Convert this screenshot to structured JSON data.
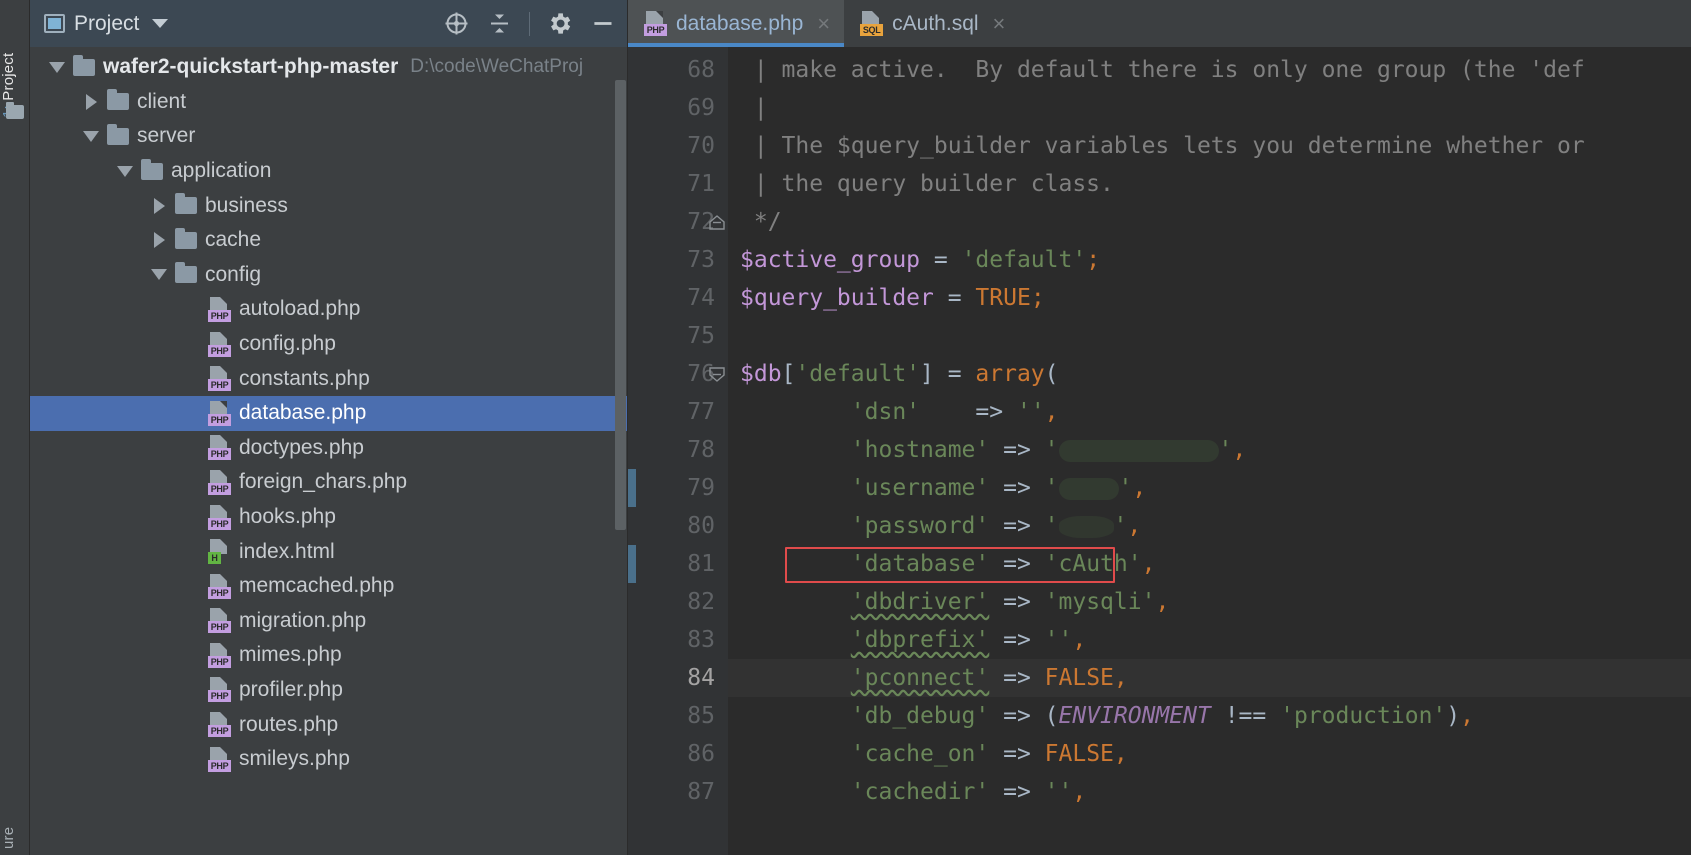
{
  "window": {
    "app": "IDE",
    "theme_bg": "#3c3f41",
    "editor_bg": "#2b2b2b",
    "accent": "#4a88c7",
    "selection": "#4b6eaf"
  },
  "tool_strip": {
    "tabs": [
      {
        "name": "project-tab",
        "num": "1:",
        "label": " Project"
      },
      {
        "name": "structure-tab",
        "label": "ure"
      }
    ],
    "folder_icon": "folder-icon"
  },
  "project_panel": {
    "header": {
      "icon": "project-window-icon",
      "title": "Project",
      "dropdown_icon": "chevron-down-icon",
      "actions": [
        {
          "name": "locate-icon",
          "glyph": "crosshair"
        },
        {
          "name": "collapse-all-icon",
          "glyph": "collapse"
        },
        {
          "name": "settings-icon",
          "glyph": "gear"
        },
        {
          "name": "hide-icon",
          "glyph": "minimize"
        }
      ]
    },
    "tree": [
      {
        "depth": 0,
        "twisty": "down",
        "icon": "folder",
        "label": "wafer2-quickstart-php-master",
        "bold": true,
        "path": "D:\\code\\WeChatProj",
        "selected": false
      },
      {
        "depth": 1,
        "twisty": "right",
        "icon": "folder",
        "label": "client",
        "selected": false
      },
      {
        "depth": 1,
        "twisty": "down",
        "icon": "folder",
        "label": "server",
        "selected": false
      },
      {
        "depth": 2,
        "twisty": "down",
        "icon": "folder",
        "label": "application",
        "selected": false
      },
      {
        "depth": 3,
        "twisty": "right",
        "icon": "folder",
        "label": "business",
        "selected": false
      },
      {
        "depth": 3,
        "twisty": "right",
        "icon": "folder",
        "label": "cache",
        "selected": false
      },
      {
        "depth": 3,
        "twisty": "down",
        "icon": "folder",
        "label": "config",
        "selected": false
      },
      {
        "depth": 4,
        "twisty": "none",
        "icon": "php",
        "label": "autoload.php",
        "selected": false
      },
      {
        "depth": 4,
        "twisty": "none",
        "icon": "php",
        "label": "config.php",
        "selected": false
      },
      {
        "depth": 4,
        "twisty": "none",
        "icon": "php",
        "label": "constants.php",
        "selected": false
      },
      {
        "depth": 4,
        "twisty": "none",
        "icon": "php",
        "label": "database.php",
        "selected": true
      },
      {
        "depth": 4,
        "twisty": "none",
        "icon": "php",
        "label": "doctypes.php",
        "selected": false
      },
      {
        "depth": 4,
        "twisty": "none",
        "icon": "php",
        "label": "foreign_chars.php",
        "selected": false
      },
      {
        "depth": 4,
        "twisty": "none",
        "icon": "php",
        "label": "hooks.php",
        "selected": false
      },
      {
        "depth": 4,
        "twisty": "none",
        "icon": "html",
        "label": "index.html",
        "selected": false
      },
      {
        "depth": 4,
        "twisty": "none",
        "icon": "php",
        "label": "memcached.php",
        "selected": false
      },
      {
        "depth": 4,
        "twisty": "none",
        "icon": "php",
        "label": "migration.php",
        "selected": false
      },
      {
        "depth": 4,
        "twisty": "none",
        "icon": "php",
        "label": "mimes.php",
        "selected": false
      },
      {
        "depth": 4,
        "twisty": "none",
        "icon": "php",
        "label": "profiler.php",
        "selected": false
      },
      {
        "depth": 4,
        "twisty": "none",
        "icon": "php",
        "label": "routes.php",
        "selected": false
      },
      {
        "depth": 4,
        "twisty": "none",
        "icon": "php",
        "label": "smileys.php",
        "selected": false
      }
    ]
  },
  "editor": {
    "tabs": [
      {
        "name": "tab-database-php",
        "label": "database.php",
        "icon": "php",
        "active": true,
        "close": "×"
      },
      {
        "name": "tab-cauth-sql",
        "label": "cAuth.sql",
        "icon": "sql",
        "active": false,
        "close": "×"
      }
    ],
    "current_line": "84",
    "line_numbers": [
      "68",
      "69",
      "70",
      "71",
      "72",
      "73",
      "74",
      "75",
      "76",
      "77",
      "78",
      "79",
      "80",
      "81",
      "82",
      "83",
      "84",
      "85",
      "86",
      "87"
    ],
    "lines": [
      {
        "n": "68",
        "text": " | make active.  By default there is only one group (the 'def"
      },
      {
        "n": "69",
        "text": " |"
      },
      {
        "n": "70",
        "text": " | The $query_builder variables lets you determine whether or"
      },
      {
        "n": "71",
        "text": " | the query builder class."
      },
      {
        "n": "72",
        "text": " */"
      },
      {
        "n": "73",
        "text": "$active_group = 'default';"
      },
      {
        "n": "74",
        "text": "$query_builder = TRUE;"
      },
      {
        "n": "75",
        "text": ""
      },
      {
        "n": "76",
        "text": "$db['default'] = array("
      },
      {
        "n": "77",
        "text": "        'dsn'\t=> '',"
      },
      {
        "n": "78",
        "text": "        'hostname' => '███████',"
      },
      {
        "n": "79",
        "text": "        'username' => '███',"
      },
      {
        "n": "80",
        "text": "        'password' => '███',"
      },
      {
        "n": "81",
        "text": "        'database' => 'cAuth',"
      },
      {
        "n": "82",
        "text": "        'dbdriver' => 'mysqli',"
      },
      {
        "n": "83",
        "text": "        'dbprefix' => '',"
      },
      {
        "n": "84",
        "text": "        'pconnect' => FALSE,"
      },
      {
        "n": "85",
        "text": "        'db_debug' => (ENVIRONMENT !== 'production'),"
      },
      {
        "n": "86",
        "text": "        'cache_on' => FALSE,"
      },
      {
        "n": "87",
        "text": "        'cachedir' => '',"
      }
    ],
    "highlight": {
      "line": "81",
      "text": "'database' => 'cAuth',",
      "border_color": "#e04b4b"
    },
    "fold_markers": [
      {
        "line": "72",
        "type": "fold-end"
      },
      {
        "line": "76",
        "type": "fold-start"
      }
    ],
    "change_markers": [
      {
        "line": "79",
        "color": "#4a708b"
      },
      {
        "line": "81",
        "color": "#4a708b"
      }
    ]
  }
}
